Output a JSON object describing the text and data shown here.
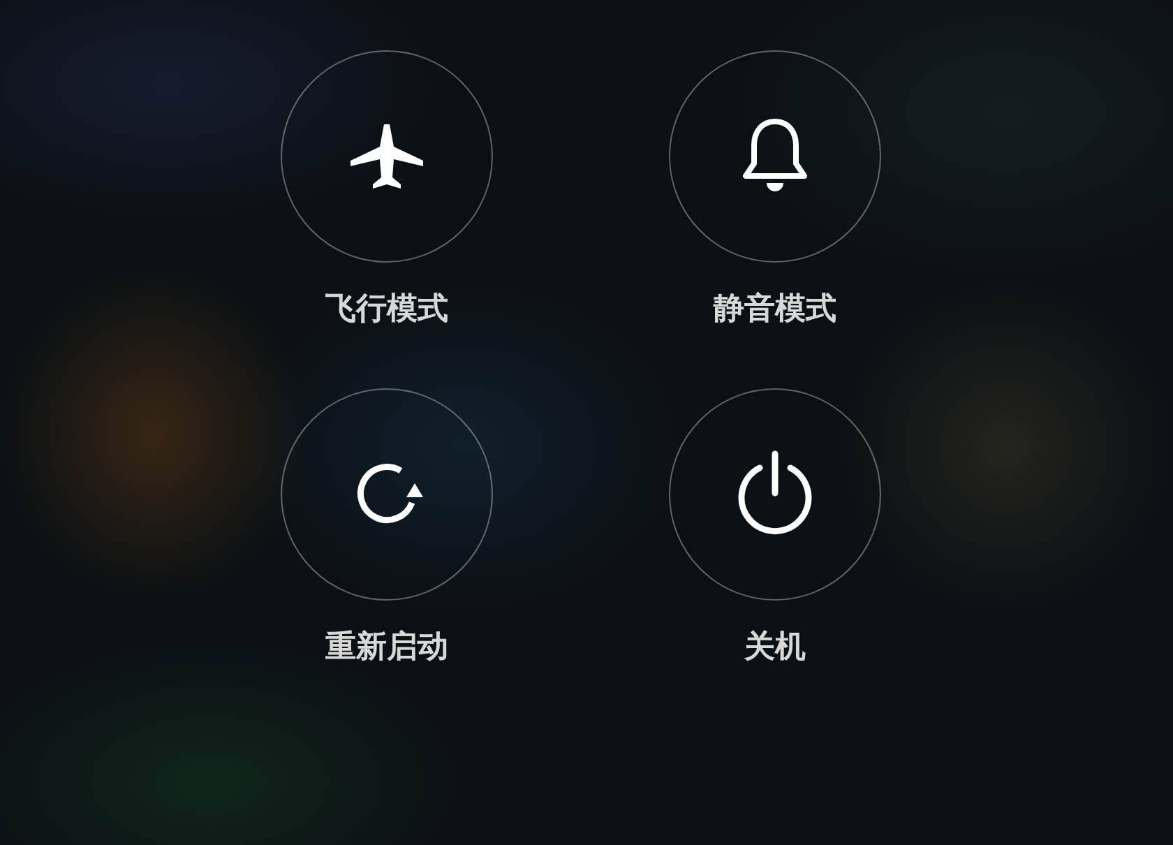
{
  "power_menu": {
    "buttons": [
      {
        "kind": "airplane",
        "label": "飞行模式"
      },
      {
        "kind": "bell",
        "label": "静音模式"
      },
      {
        "kind": "restart",
        "label": "重新启动"
      },
      {
        "kind": "power",
        "label": "关机"
      }
    ]
  }
}
